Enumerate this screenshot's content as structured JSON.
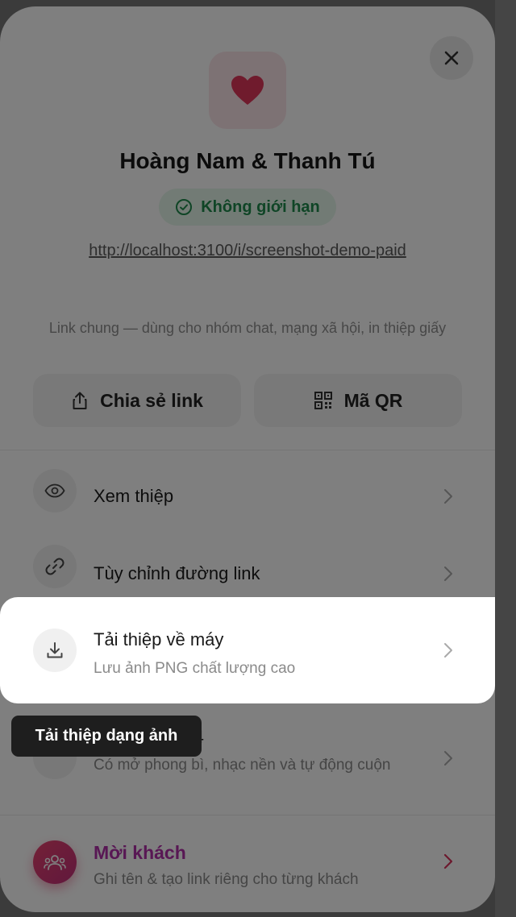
{
  "dialog": {
    "couple_name": "Hoàng Nam & Thanh Tú",
    "status_badge": "Không giới hạn",
    "invite_url": "http://localhost:3100/i/screenshot-demo-paid",
    "share_description": "Link chung — dùng cho nhóm chat, mạng xã hội, in thiệp giấy",
    "share_button_label": "Chia sẻ link",
    "qr_button_label": "Mã QR"
  },
  "menu": {
    "view_card": {
      "title": "Xem thiệp"
    },
    "customize_link": {
      "title": "Tùy chỉnh đường link"
    },
    "download_card": {
      "title": "Tải thiệp về máy",
      "subtitle": "Lưu ảnh PNG chất lượng cao"
    },
    "video_mp4": {
      "title_visible_fragment": "P4",
      "subtitle": "Có mở phong bì, nhạc nền và tự động cuộn"
    },
    "invite_guests": {
      "title": "Mời khách",
      "subtitle": "Ghi tên & tạo link riêng cho từng khách"
    }
  },
  "tooltip": {
    "text": "Tải thiệp dạng ảnh"
  },
  "colors": {
    "heart": "#e0365a",
    "status_green": "#1f8a4c",
    "invite_purple": "#b12fa8",
    "invite_chevron": "#d8335a"
  },
  "icons": {
    "close": "close-icon",
    "heart": "heart-icon",
    "status": "check-circle-icon",
    "share": "share-icon",
    "qr": "qr-code-icon",
    "view": "eye-icon",
    "link": "link-icon",
    "download": "download-icon",
    "invite": "users-icon",
    "chevron": "chevron-right-icon"
  }
}
